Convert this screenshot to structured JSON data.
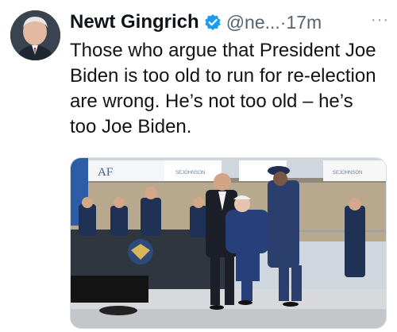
{
  "tweet": {
    "author_name": "Newt Gingrich",
    "handle": "@ne...",
    "separator": "·",
    "time": "17m",
    "more_label": "···",
    "text": "Those who argue that President Joe Biden is too old to run for re-election are wrong. He’s not too old – he’s too Joe Biden.",
    "verified": true
  },
  "media": {
    "signs": [
      "AF",
      "SEJOHNSON",
      "SEJOHNSON"
    ]
  },
  "colors": {
    "verified_blue": "#1d9bf0",
    "text": "#0f1419",
    "muted": "#536471"
  }
}
